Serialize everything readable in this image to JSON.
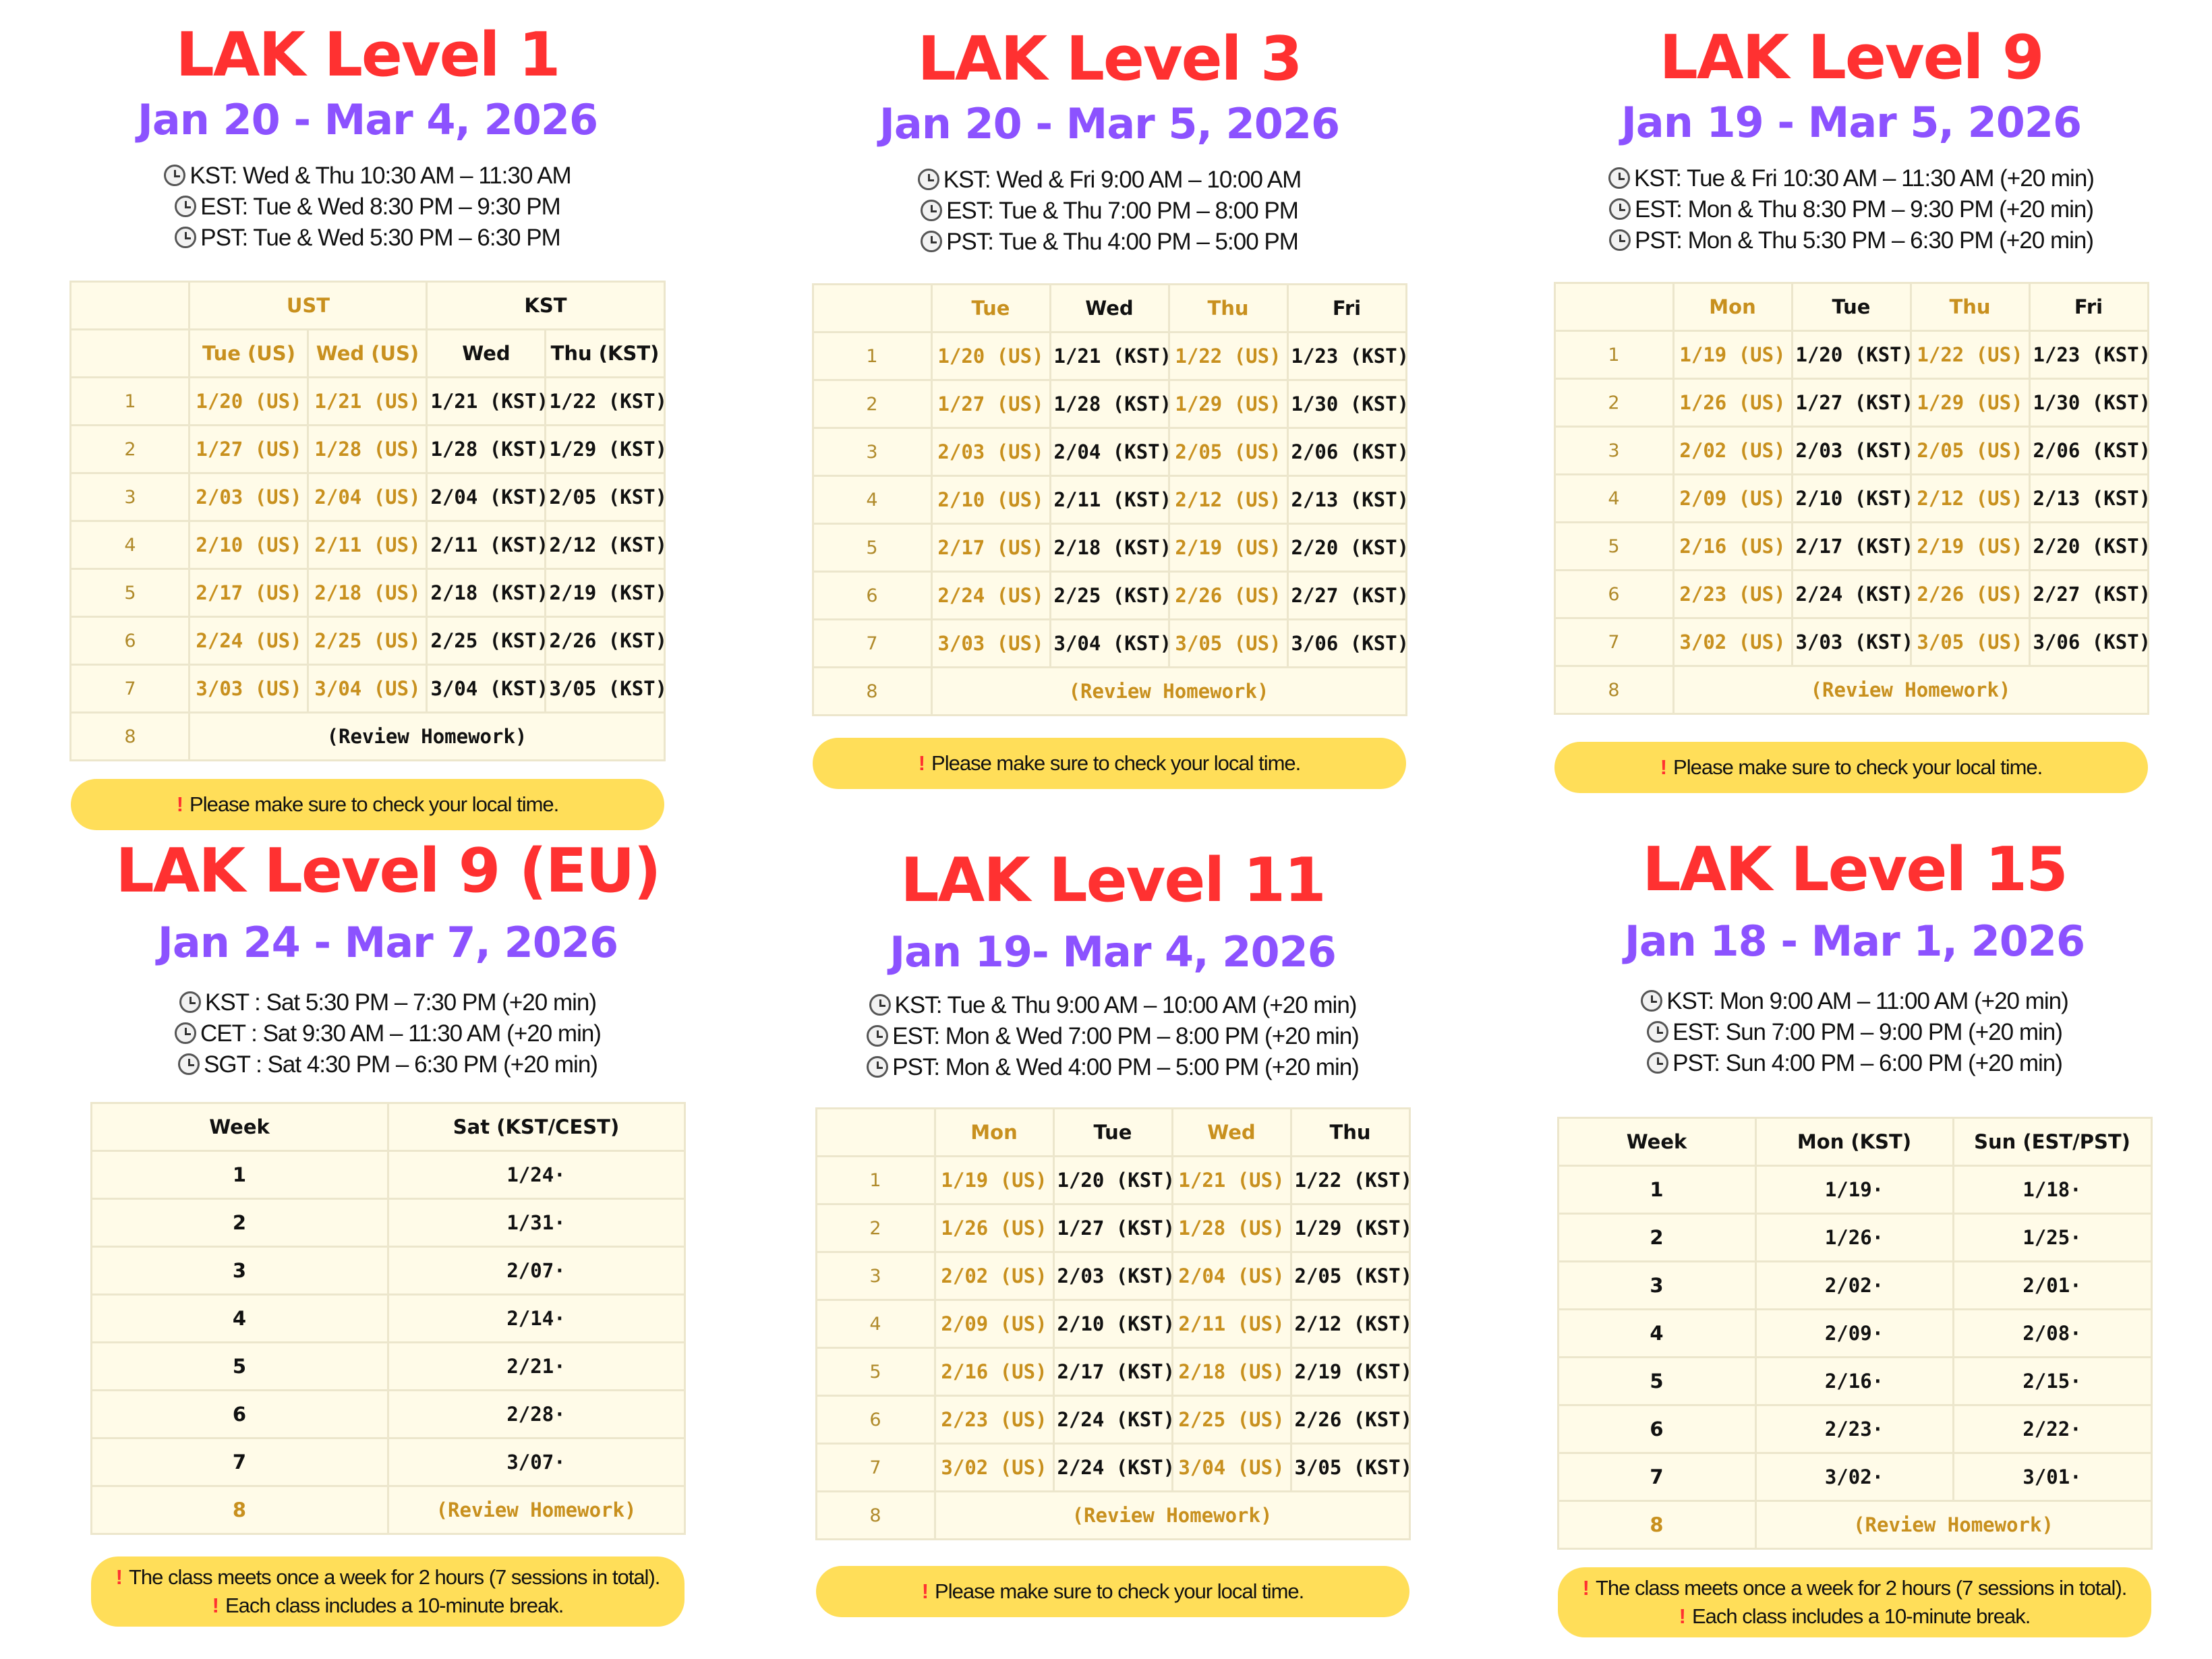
{
  "cards": [
    {
      "title": "LAK Level 1",
      "dates": "Jan 20 - Mar 4, 2026",
      "times": [
        "KST: Wed & Thu 10:30 AM – 11:30 AM",
        "EST: Tue & Wed 8:30 PM – 9:30 PM",
        "PST:  Tue & Wed 5:30 PM – 6:30 PM"
      ],
      "group_headers": [
        "UST",
        "KST"
      ],
      "headers": [
        "Tue (US)",
        "Wed (US)",
        "Wed",
        "Thu (KST)"
      ],
      "rows": [
        [
          "1",
          "1/20 (US)",
          "1/21 (US)",
          "1/21 (KST)",
          "1/22 (KST)"
        ],
        [
          "2",
          "1/27 (US)",
          "1/28 (US)",
          "1/28 (KST)",
          "1/29 (KST)"
        ],
        [
          "3",
          "2/03 (US)",
          "2/04 (US)",
          "2/04 (KST)",
          "2/05 (KST)"
        ],
        [
          "4",
          "2/10 (US)",
          "2/11 (US)",
          "2/11 (KST)",
          "2/12 (KST)"
        ],
        [
          "5",
          "2/17 (US)",
          "2/18 (US)",
          "2/18 (KST)",
          "2/19 (KST)"
        ],
        [
          "6",
          "2/24 (US)",
          "2/25 (US)",
          "2/25 (KST)",
          "2/26 (KST)"
        ],
        [
          "7",
          "3/03 (US)",
          "3/04 (US)",
          "3/04 (KST)",
          "3/05 (KST)"
        ]
      ],
      "review_week": "8",
      "review": "(Review Homework)",
      "notes": [
        "Please make sure to check your local time."
      ]
    },
    {
      "title": "LAK Level 3",
      "dates": "Jan 20 - Mar 5, 2026",
      "times": [
        "KST: Wed & Fri 9:00 AM – 10:00 AM",
        "EST: Tue & Thu 7:00 PM – 8:00 PM",
        "PST: Tue & Thu 4:00 PM – 5:00 PM"
      ],
      "headers": [
        "Tue",
        "Wed",
        "Thu",
        "Fri"
      ],
      "rows": [
        [
          "1",
          "1/20 (US)",
          "1/21 (KST)",
          "1/22 (US)",
          "1/23 (KST)"
        ],
        [
          "2",
          "1/27 (US)",
          "1/28 (KST)",
          "1/29 (US)",
          "1/30 (KST)"
        ],
        [
          "3",
          "2/03 (US)",
          "2/04 (KST)",
          "2/05 (US)",
          "2/06 (KST)"
        ],
        [
          "4",
          "2/10 (US)",
          "2/11 (KST)",
          "2/12 (US)",
          "2/13 (KST)"
        ],
        [
          "5",
          "2/17 (US)",
          "2/18 (KST)",
          "2/19 (US)",
          "2/20 (KST)"
        ],
        [
          "6",
          "2/24 (US)",
          "2/25 (KST)",
          "2/26 (US)",
          "2/27 (KST)"
        ],
        [
          "7",
          "3/03 (US)",
          "3/04 (KST)",
          "3/05 (US)",
          "3/06 (KST)"
        ]
      ],
      "review_week": "8",
      "review": "(Review Homework)",
      "notes": [
        "Please make sure to check your local time."
      ]
    },
    {
      "title": "LAK Level 9",
      "dates": "Jan 19 - Mar 5, 2026",
      "times": [
        "KST: Tue & Fri 10:30 AM – 11:30 AM (+20 min)",
        "EST: Mon & Thu 8:30 PM – 9:30 PM (+20 min)",
        "PST: Mon & Thu 5:30 PM – 6:30 PM (+20 min)"
      ],
      "headers": [
        "Mon",
        "Tue",
        "Thu",
        "Fri"
      ],
      "rows": [
        [
          "1",
          "1/19 (US)",
          "1/20 (KST)",
          "1/22 (US)",
          "1/23 (KST)"
        ],
        [
          "2",
          "1/26 (US)",
          "1/27 (KST)",
          "1/29 (US)",
          "1/30 (KST)"
        ],
        [
          "3",
          "2/02 (US)",
          "2/03 (KST)",
          "2/05 (US)",
          "2/06 (KST)"
        ],
        [
          "4",
          "2/09 (US)",
          "2/10 (KST)",
          "2/12 (US)",
          "2/13 (KST)"
        ],
        [
          "5",
          "2/16 (US)",
          "2/17 (KST)",
          "2/19 (US)",
          "2/20 (KST)"
        ],
        [
          "6",
          "2/23 (US)",
          "2/24 (KST)",
          "2/26 (US)",
          "2/27 (KST)"
        ],
        [
          "7",
          "3/02 (US)",
          "3/03 (KST)",
          "3/05 (US)",
          "3/06 (KST)"
        ]
      ],
      "review_week": "8",
      "review": "(Review Homework)",
      "notes": [
        "Please make sure to check your local time."
      ]
    },
    {
      "title": "LAK Level 9 (EU)",
      "dates": "Jan 24 - Mar 7, 2026",
      "times": [
        "KST : Sat 5:30 PM – 7:30 PM (+20 min)",
        "CET : Sat 9:30 AM – 11:30 AM (+20 min)",
        "SGT : Sat 4:30 PM – 6:30 PM (+20 min)"
      ],
      "headers": [
        "Week",
        "Sat (KST/CEST)"
      ],
      "rows": [
        [
          "1",
          "1/24·"
        ],
        [
          "2",
          "1/31·"
        ],
        [
          "3",
          "2/07·"
        ],
        [
          "4",
          "2/14·"
        ],
        [
          "5",
          "2/21·"
        ],
        [
          "6",
          "2/28·"
        ],
        [
          "7",
          "3/07·"
        ]
      ],
      "review_week": "8",
      "review": "(Review Homework)",
      "notes": [
        "The class meets once a week for 2 hours (7 sessions in total).",
        "Each class includes a 10-minute break."
      ]
    },
    {
      "title": "LAK Level 11",
      "dates": "Jan 19- Mar 4, 2026",
      "times": [
        "KST: Tue & Thu 9:00 AM – 10:00 AM (+20 min)",
        "EST: Mon & Wed 7:00 PM – 8:00 PM (+20 min)",
        "PST: Mon & Wed 4:00 PM – 5:00 PM (+20 min)"
      ],
      "headers": [
        "Mon",
        "Tue",
        "Wed",
        "Thu"
      ],
      "rows": [
        [
          "1",
          "1/19 (US)",
          "1/20 (KST)",
          "1/21 (US)",
          "1/22 (KST)"
        ],
        [
          "2",
          "1/26 (US)",
          "1/27 (KST)",
          "1/28 (US)",
          "1/29 (KST)"
        ],
        [
          "3",
          "2/02 (US)",
          "2/03 (KST)",
          "2/04 (US)",
          "2/05 (KST)"
        ],
        [
          "4",
          "2/09 (US)",
          "2/10 (KST)",
          "2/11 (US)",
          "2/12 (KST)"
        ],
        [
          "5",
          "2/16 (US)",
          "2/17 (KST)",
          "2/18 (US)",
          "2/19 (KST)"
        ],
        [
          "6",
          "2/23 (US)",
          "2/24 (KST)",
          "2/25 (US)",
          "2/26 (KST)"
        ],
        [
          "7",
          "3/02 (US)",
          "2/24 (KST)",
          "3/04 (US)",
          "3/05 (KST)"
        ]
      ],
      "review_week": "8",
      "review": "(Review Homework)",
      "notes": [
        "Please make sure to check your local time."
      ]
    },
    {
      "title": "LAK Level 15",
      "dates": "Jan 18 - Mar 1, 2026",
      "times": [
        "KST: Mon 9:00 AM – 11:00 AM (+20 min)",
        "EST: Sun 7:00 PM – 9:00 PM (+20 min)",
        "PST: Sun 4:00 PM – 6:00 PM (+20 min)"
      ],
      "headers": [
        "Week",
        "Mon (KST)",
        "Sun (EST/PST)"
      ],
      "rows": [
        [
          "1",
          "1/19·",
          "1/18·"
        ],
        [
          "2",
          "1/26·",
          "1/25·"
        ],
        [
          "3",
          "2/02·",
          "2/01·"
        ],
        [
          "4",
          "2/09·",
          "2/08·"
        ],
        [
          "5",
          "2/16·",
          "2/15·"
        ],
        [
          "6",
          "2/23·",
          "2/22·"
        ],
        [
          "7",
          "3/02·",
          "3/01·"
        ]
      ],
      "review_week": "8",
      "review": "(Review Homework)",
      "notes": [
        "The class meets once a week for 2 hours (7 sessions in total).",
        "Each class includes a 10-minute break."
      ]
    }
  ]
}
